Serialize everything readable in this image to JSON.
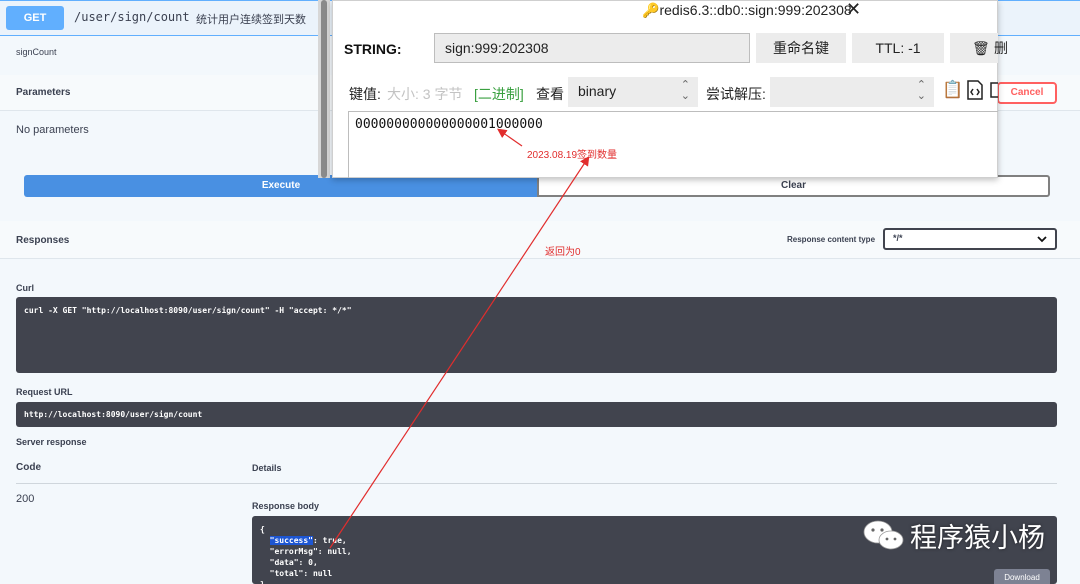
{
  "operation": {
    "method": "GET",
    "path": "/user/sign/count",
    "description": "统计用户连续签到天数",
    "summary": "signCount",
    "parameters_title": "Parameters",
    "cancel_label": "Cancel",
    "no_parameters": "No parameters",
    "execute_label": "Execute",
    "clear_label": "Clear"
  },
  "responses": {
    "title": "Responses",
    "content_type_label": "Response content type",
    "content_type_value": "*/*",
    "curl_label": "Curl",
    "curl_command": "curl -X GET \"http://localhost:8090/user/sign/count\" -H \"accept: */*\"",
    "request_url_label": "Request URL",
    "request_url": "http://localhost:8090/user/sign/count",
    "server_response_label": "Server response",
    "code_header": "Code",
    "details_header": "Details",
    "code": "200",
    "body_label": "Response body",
    "body_line1": "{",
    "body_success_key": "\"success\"",
    "body_success_rest": ": true,",
    "body_line3": "  \"errorMsg\": null,",
    "body_line4": "  \"data\": 0,",
    "body_line5": "  \"total\": null",
    "body_line6": "}",
    "download_label": "Download"
  },
  "redis": {
    "title": "redis6.3::db0::sign:999:202308",
    "type_label": "STRING:",
    "key_name": "sign:999:202308",
    "rename_label": "重命名键",
    "ttl_label": "TTL:  -1",
    "delete_label": "删",
    "value_label": "键值:",
    "size_text": "大小: 3 字节",
    "binary_tag": "[二进制]",
    "view_label": "查看",
    "view_mode": "binary",
    "decompress_label": "尝试解压:",
    "decompress_value": "",
    "value": "000000000000000001000000"
  },
  "annotations": {
    "sign_count_note": "2023.08.19签到数量",
    "return_note": "返回为0",
    "watermark": "程序猿小杨"
  },
  "colors": {
    "get_blue": "#61affe",
    "execute_blue": "#4990e2",
    "cancel_red": "#ff6060",
    "annotation_red": "#e12d2d",
    "binary_green": "#3aa040"
  }
}
